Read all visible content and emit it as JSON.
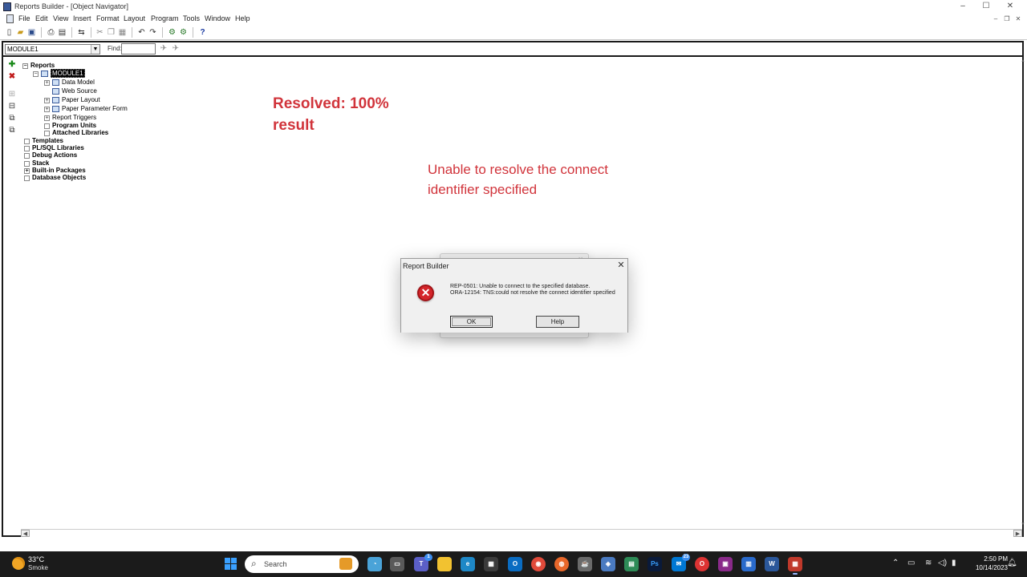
{
  "window": {
    "title": "Reports Builder - [Object Navigator]",
    "controls": {
      "minimize": "–",
      "maximize": "☐",
      "close": "✕"
    }
  },
  "menu": {
    "items": [
      "File",
      "Edit",
      "View",
      "Insert",
      "Format",
      "Layout",
      "Program",
      "Tools",
      "Window",
      "Help"
    ]
  },
  "toolbar": {
    "icons": [
      "new-icon",
      "open-icon",
      "save-icon",
      "print-icon",
      "page-setup-icon",
      "connect-icon",
      "cut-icon",
      "copy-icon",
      "paste-icon",
      "undo-icon",
      "redo-icon",
      "compile-icon",
      "run-icon",
      "help-icon"
    ]
  },
  "navigator": {
    "module_select": "MODULE1",
    "find_label": "Find:",
    "find_value": "",
    "tree": {
      "reports": "Reports",
      "module": "MODULE1",
      "data_model": "Data Model",
      "web_source": "Web Source",
      "paper_layout": "Paper Layout",
      "paper_parameter_form": "Paper Parameter Form",
      "report_triggers": "Report Triggers",
      "program_units": "Program Units",
      "attached_libraries": "Attached Libraries",
      "templates": "Templates",
      "plsql_libraries": "PL/SQL Libraries",
      "debug_actions": "Debug Actions",
      "stack": "Stack",
      "builtin_packages": "Built-in Packages",
      "database_objects": "Database Objects"
    },
    "expanders": {
      "plus": "+",
      "minus": "−"
    }
  },
  "annotations": {
    "resolved_line1": "Resolved: 100%",
    "resolved_line2": "result",
    "error_line1": "Unable to resolve the connect",
    "error_line2": "identifier specified"
  },
  "dialog": {
    "title": "Report Builder",
    "close": "✕",
    "message_line1": "REP-0501: Unable to connect to the specified database.",
    "message_line2": "ORA-12154: TNS:could not resolve the connect identifier specified",
    "ok_label": "OK",
    "help_label": "Help",
    "icon": "error-icon"
  },
  "taskbar": {
    "weather_temp": "33°C",
    "weather_desc": "Smoke",
    "search_placeholder": "Search",
    "badges": {
      "teams": "1",
      "outlook_ext": "23"
    },
    "time": "2:50 PM",
    "date": "10/14/2023",
    "colors": {
      "accent_red": "#d1343b",
      "taskbar_bg": "#1b1b1b"
    }
  }
}
